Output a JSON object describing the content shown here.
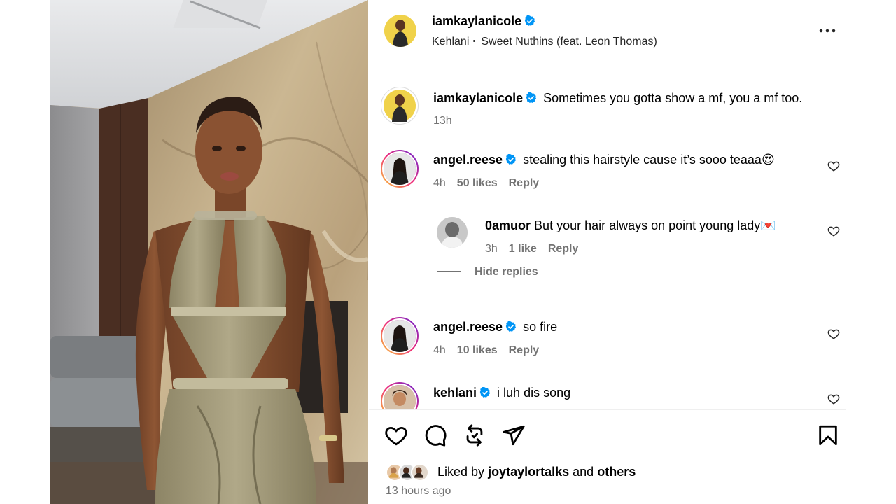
{
  "post": {
    "username": "iamkaylanicole",
    "music_artist": "Kehlani",
    "music_track": "Sweet Nuthins (feat. Leon Thomas)"
  },
  "caption": {
    "username": "iamkaylanicole",
    "text": "Sometimes you gotta show a mf, you a mf too.",
    "time": "13h"
  },
  "comments": [
    {
      "username": "angel.reese",
      "text": "stealing this hairstyle cause it’s sooo teaaa😍",
      "time": "4h",
      "likes": "50 likes",
      "reply": "Reply"
    },
    {
      "username": "0amuor",
      "text": "But your hair always on point young lady💌",
      "time": "3h",
      "likes": "1 like",
      "reply": "Reply",
      "hide_replies": "Hide replies"
    },
    {
      "username": "angel.reese",
      "text": "so fire",
      "time": "4h",
      "likes": "10 likes",
      "reply": "Reply"
    },
    {
      "username": "kehlani",
      "text": "i luh dis song"
    }
  ],
  "footer": {
    "liked_by_prefix": "Liked by",
    "liked_by_user": "joytaylortalks",
    "liked_by_and": "and",
    "liked_by_others": "others",
    "time_ago": "13 hours ago"
  },
  "icons": {
    "verified": "verified-badge-icon",
    "more": "more-options-icon",
    "like": "heart-icon",
    "comment": "comment-icon",
    "repost": "repost-icon",
    "share": "share-icon",
    "save": "bookmark-icon"
  },
  "colors": {
    "verified_blue": "#0095f6",
    "muted_text": "#737373"
  }
}
